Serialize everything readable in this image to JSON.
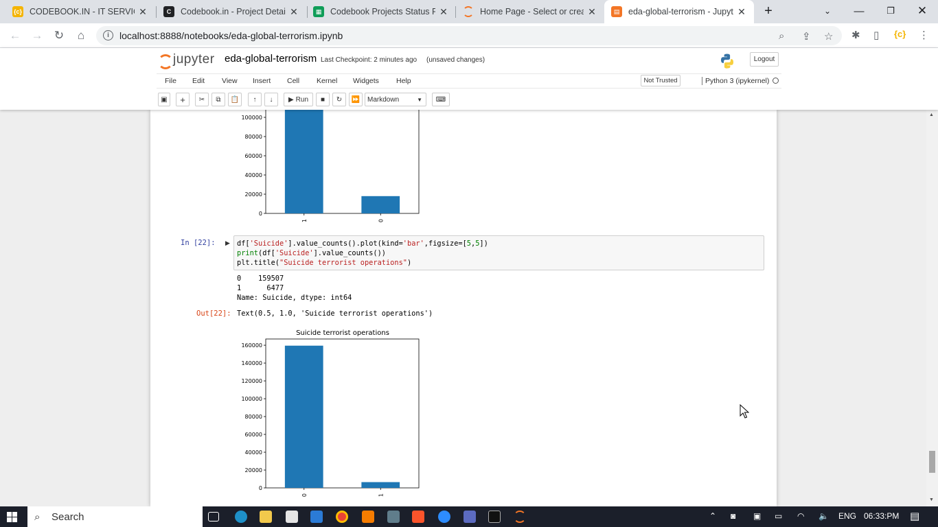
{
  "browser": {
    "tabs": [
      {
        "title": "CODEBOOK.IN - IT SERVICES",
        "icon": "codebook-favicon-icon",
        "color": "#f4b400",
        "active": false
      },
      {
        "title": "Codebook.in - Project Details",
        "icon": "codebook-dark-favicon-icon",
        "color": "#202124",
        "active": false
      },
      {
        "title": "Codebook Projects Status Re",
        "icon": "google-sheets-icon",
        "color": "#0f9d58",
        "active": false
      },
      {
        "title": "Home Page - Select or create",
        "icon": "jupyter-favicon-icon",
        "color": "#f37626",
        "active": false
      },
      {
        "title": "eda-global-terrorism - Jupyt",
        "icon": "notebook-favicon-icon",
        "color": "#f37626",
        "active": true
      }
    ],
    "url": "localhost:8888/notebooks/eda-global-terrorism.ipynb"
  },
  "jupyter": {
    "logo_text": "jupyter",
    "notebook_name": "eda-global-terrorism",
    "checkpoint": "Last Checkpoint: 2 minutes ago",
    "unsaved": "(unsaved changes)",
    "logout_label": "Logout",
    "menus": [
      "File",
      "Edit",
      "View",
      "Insert",
      "Cell",
      "Kernel",
      "Widgets",
      "Help"
    ],
    "trust_label": "Not Trusted",
    "kernel_label": "Python 3 (ipykernel)",
    "run_label": "Run",
    "cell_type": "Markdown"
  },
  "cells": {
    "in_prompt": "In [22]:",
    "code_lines": [
      "df['Suicide'].value_counts().plot(kind='bar',figsize=[5,5])",
      "print(df['Suicide'].value_counts())",
      "plt.title(\"Suicide terrorist operations\")"
    ],
    "stdout_lines": [
      "0    159507",
      "1      6477",
      "Name: Suicide, dtype: int64"
    ],
    "out_prompt": "Out[22]:",
    "out_text": "Text(0.5, 1.0, 'Suicide terrorist operations')"
  },
  "chart_data": [
    {
      "type": "bar",
      "title": "",
      "categories": [
        "1",
        "0"
      ],
      "values": [
        110000,
        18000
      ],
      "yticks": [
        "0",
        "20000",
        "40000",
        "60000",
        "80000",
        "100000"
      ],
      "ylim": [
        0,
        110000
      ],
      "color": "#1f77b4"
    },
    {
      "type": "bar",
      "title": "Suicide terrorist operations",
      "categories": [
        "0",
        "1"
      ],
      "values": [
        159507,
        6477
      ],
      "yticks": [
        "0",
        "20000",
        "40000",
        "60000",
        "80000",
        "100000",
        "120000",
        "140000",
        "160000"
      ],
      "ylim": [
        0,
        167000
      ],
      "color": "#1f77b4"
    }
  ],
  "taskbar": {
    "search_placeholder": "Search",
    "lang": "ENG",
    "time": "06:33:PM"
  }
}
